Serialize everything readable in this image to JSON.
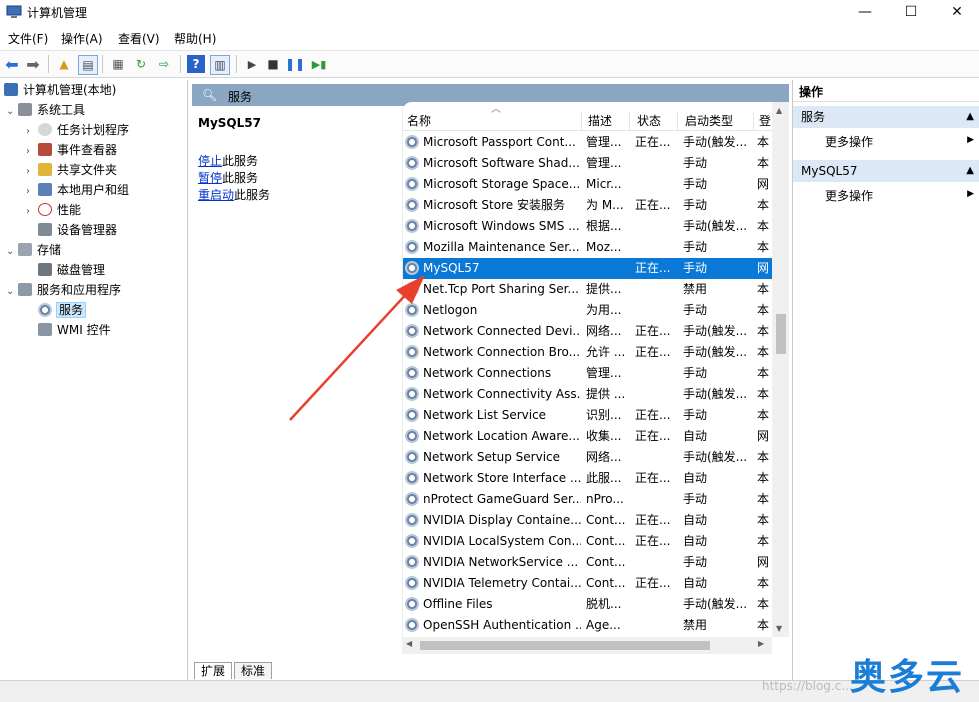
{
  "window": {
    "title": "计算机管理",
    "min": "—",
    "max": "☐",
    "close": "✕"
  },
  "menu": [
    "文件(F)",
    "操作(A)",
    "查看(V)",
    "帮助(H)"
  ],
  "tree": {
    "root": "计算机管理(本地)",
    "system_tools": "系统工具",
    "task_scheduler": "任务计划程序",
    "event_viewer": "事件查看器",
    "shared_folders": "共享文件夹",
    "local_users": "本地用户和组",
    "performance": "性能",
    "device_manager": "设备管理器",
    "storage": "存储",
    "disk_mgmt": "磁盘管理",
    "services_apps": "服务和应用程序",
    "services": "服务",
    "wmi": "WMI 控件"
  },
  "center": {
    "header": "服务",
    "selected_service": "MySQL57",
    "stop": "停止",
    "stop_suffix": "此服务",
    "pause": "暂停",
    "pause_suffix": "此服务",
    "restart": "重启动",
    "restart_suffix": "此服务"
  },
  "columns": {
    "name": "名称",
    "desc": "描述",
    "status": "状态",
    "startup": "启动类型",
    "logon": "登"
  },
  "rows": [
    {
      "name": "Microsoft Passport Cont...",
      "desc": "管理...",
      "status": "正在...",
      "startup": "手动(触发...",
      "logon": "本"
    },
    {
      "name": "Microsoft Software Shad...",
      "desc": "管理...",
      "status": "",
      "startup": "手动",
      "logon": "本"
    },
    {
      "name": "Microsoft Storage Space...",
      "desc": "Micr...",
      "status": "",
      "startup": "手动",
      "logon": "网"
    },
    {
      "name": "Microsoft Store 安装服务",
      "desc": "为 M...",
      "status": "正在...",
      "startup": "手动",
      "logon": "本"
    },
    {
      "name": "Microsoft Windows SMS ...",
      "desc": "根据...",
      "status": "",
      "startup": "手动(触发...",
      "logon": "本"
    },
    {
      "name": "Mozilla Maintenance Ser...",
      "desc": "Moz...",
      "status": "",
      "startup": "手动",
      "logon": "本"
    },
    {
      "name": "MySQL57",
      "desc": "",
      "status": "正在...",
      "startup": "手动",
      "logon": "网"
    },
    {
      "name": "Net.Tcp Port Sharing Ser...",
      "desc": "提供...",
      "status": "",
      "startup": "禁用",
      "logon": "本"
    },
    {
      "name": "Netlogon",
      "desc": "为用...",
      "status": "",
      "startup": "手动",
      "logon": "本"
    },
    {
      "name": "Network Connected Devi...",
      "desc": "网络...",
      "status": "正在...",
      "startup": "手动(触发...",
      "logon": "本"
    },
    {
      "name": "Network Connection Bro...",
      "desc": "允许 ...",
      "status": "正在...",
      "startup": "手动(触发...",
      "logon": "本"
    },
    {
      "name": "Network Connections",
      "desc": "管理...",
      "status": "",
      "startup": "手动",
      "logon": "本"
    },
    {
      "name": "Network Connectivity Ass...",
      "desc": "提供 ...",
      "status": "",
      "startup": "手动(触发...",
      "logon": "本"
    },
    {
      "name": "Network List Service",
      "desc": "识别...",
      "status": "正在...",
      "startup": "手动",
      "logon": "本"
    },
    {
      "name": "Network Location Aware...",
      "desc": "收集...",
      "status": "正在...",
      "startup": "自动",
      "logon": "网"
    },
    {
      "name": "Network Setup Service",
      "desc": "网络...",
      "status": "",
      "startup": "手动(触发...",
      "logon": "本"
    },
    {
      "name": "Network Store Interface ...",
      "desc": "此服...",
      "status": "正在...",
      "startup": "自动",
      "logon": "本"
    },
    {
      "name": "nProtect GameGuard Ser...",
      "desc": "nPro...",
      "status": "",
      "startup": "手动",
      "logon": "本"
    },
    {
      "name": "NVIDIA Display Containe...",
      "desc": "Cont...",
      "status": "正在...",
      "startup": "自动",
      "logon": "本"
    },
    {
      "name": "NVIDIA LocalSystem Con...",
      "desc": "Cont...",
      "status": "正在...",
      "startup": "自动",
      "logon": "本"
    },
    {
      "name": "NVIDIA NetworkService ...",
      "desc": "Cont...",
      "status": "",
      "startup": "手动",
      "logon": "网"
    },
    {
      "name": "NVIDIA Telemetry Contai...",
      "desc": "Cont...",
      "status": "正在...",
      "startup": "自动",
      "logon": "本"
    },
    {
      "name": "Offline Files",
      "desc": "脱机...",
      "status": "",
      "startup": "手动(触发...",
      "logon": "本"
    },
    {
      "name": "OpenSSH Authentication ...",
      "desc": "Age...",
      "status": "",
      "startup": "禁用",
      "logon": "本"
    }
  ],
  "tabs": {
    "extended": "扩展",
    "standard": "标准"
  },
  "actions": {
    "title": "操作",
    "section1": "服务",
    "more1": "更多操作",
    "section2": "MySQL57",
    "more2": "更多操作"
  },
  "watermark": {
    "text": "奥多云",
    "url": "https://blog.c..."
  },
  "colors": {
    "selection": "#0a78d7",
    "header": "#8aa6c2",
    "arrow": "#e8402f"
  }
}
